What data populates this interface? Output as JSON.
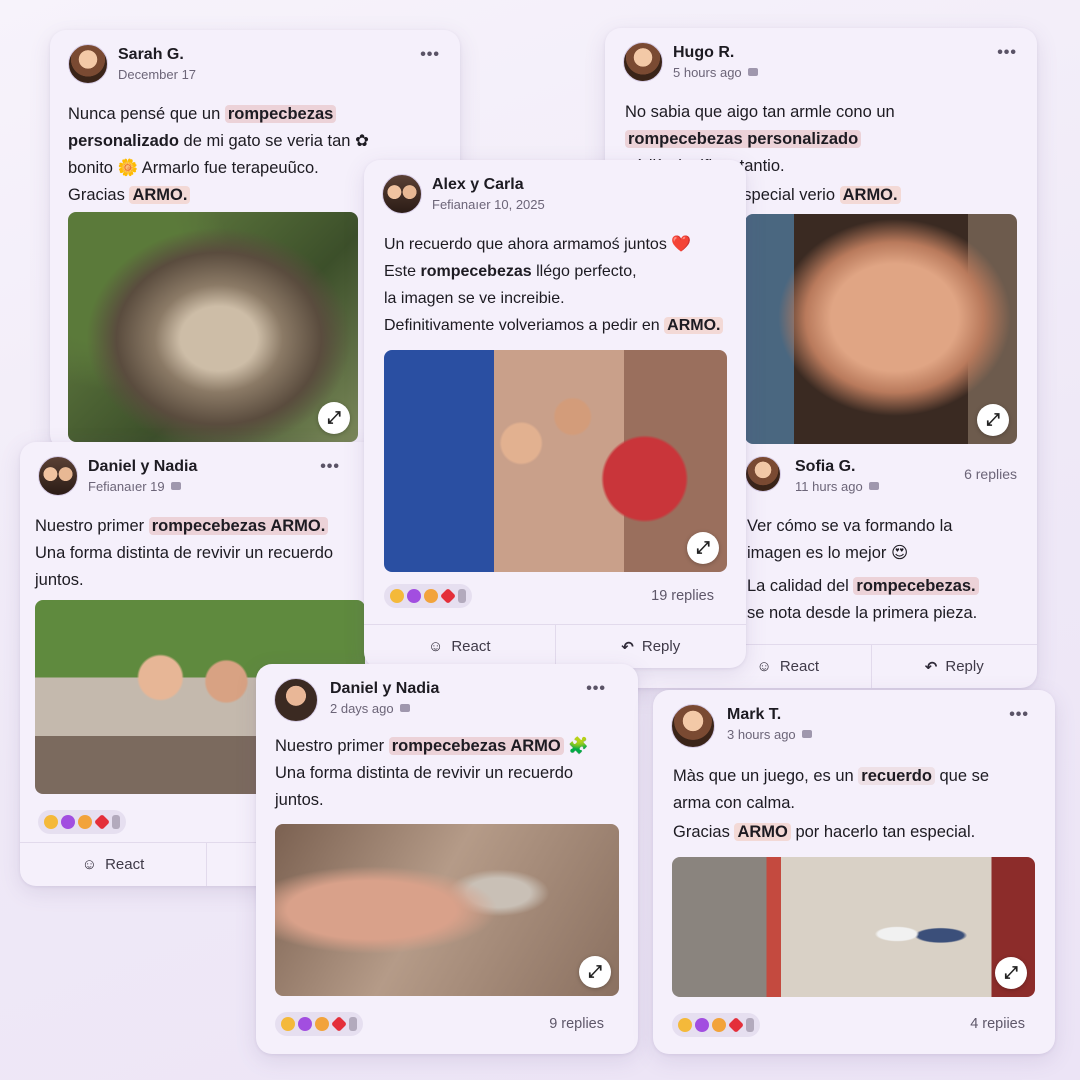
{
  "cards": {
    "sarah": {
      "name": "Sarah G.",
      "time": "December 17",
      "menu": "•••",
      "l1a": "Nunca pensé que un ",
      "l1b": "rompecbezas",
      "l2a": "personalizado",
      "l2b": " de mi gato se veria tan",
      "l3": "bonito 🌼 Armarlo fue terapeuũco.",
      "l4a": "Gracias ",
      "l4b": "ARMO."
    },
    "hugo": {
      "name": "Hugo R.",
      "time": "5 hours ago",
      "menu": "•••",
      "l1": "No sabia que aigo tan armle cono un",
      "l2": "rompecebezas personalizado",
      "l3": "pódjà significar tantio.",
      "l4a": "Se siente muy especial verio ",
      "l4b": "ARMO."
    },
    "alex": {
      "name": "Alex y Carla",
      "time": "Fefianaıer 10, 2025",
      "l1": "Un recuerdo que ahora armamoś juntos ❤️",
      "l2a": "Este ",
      "l2b": "rompecebezas",
      "l2c": " llégo perfecto,",
      "l3": "la imagen se ve increibie.",
      "l4a": "Definitivamente volveriamos a pedir en ",
      "l4b": "ARMO.",
      "replies": "19 replies",
      "react": "React",
      "reply": "Reply"
    },
    "sofia": {
      "name": "Sofia G.",
      "time": "11 hurs ago",
      "replies": "6 replies",
      "l1": "Ver cómo se va formando la",
      "l2": "imagen es lo mejor 😍",
      "l3a": "La calidad del ",
      "l3b": "rompecebezas.",
      "l4": "se nota desde la primera pieza.",
      "react": "React",
      "reply": "Reply"
    },
    "daniel1": {
      "name": "Daniel y Nadia",
      "time": "Fefianaıer 19",
      "menu": "•••",
      "l1a": "Nuestro primer ",
      "l1b": "rompecebezas ARMO.",
      "l2": "Una forma distinta de revivir un recuerdo",
      "l3": "juntos.",
      "react": "React"
    },
    "daniel2": {
      "name": "Daniel y Nadia",
      "time": "2 days ago",
      "menu": "•••",
      "l1a": "Nuestro primer ",
      "l1b": "rompecebezas ARMO",
      "l2": "Una forma distinta de revivir un recuerdo",
      "l3": "juntos.",
      "replies": "9 replies"
    },
    "mark": {
      "name": "Mark T.",
      "time": "3 hours ago",
      "menu": "•••",
      "l1a": "Màs que un juego, es un ",
      "l1b": "recuerdo",
      "l1c": " que se",
      "l2": "arma con calma.",
      "l3a": "Gracias ",
      "l3b": "ARMO",
      "l3c": " por hacerlo tan especial.",
      "replies": "4 repiies"
    }
  },
  "icons": {
    "expand": "expand-icon",
    "react": "react-icon",
    "reply": "reply-icon",
    "menu": "more-icon"
  },
  "colors": {
    "highlight": "#ecd2d8",
    "card": "#f5f0fb",
    "background": "#efe9f7"
  }
}
